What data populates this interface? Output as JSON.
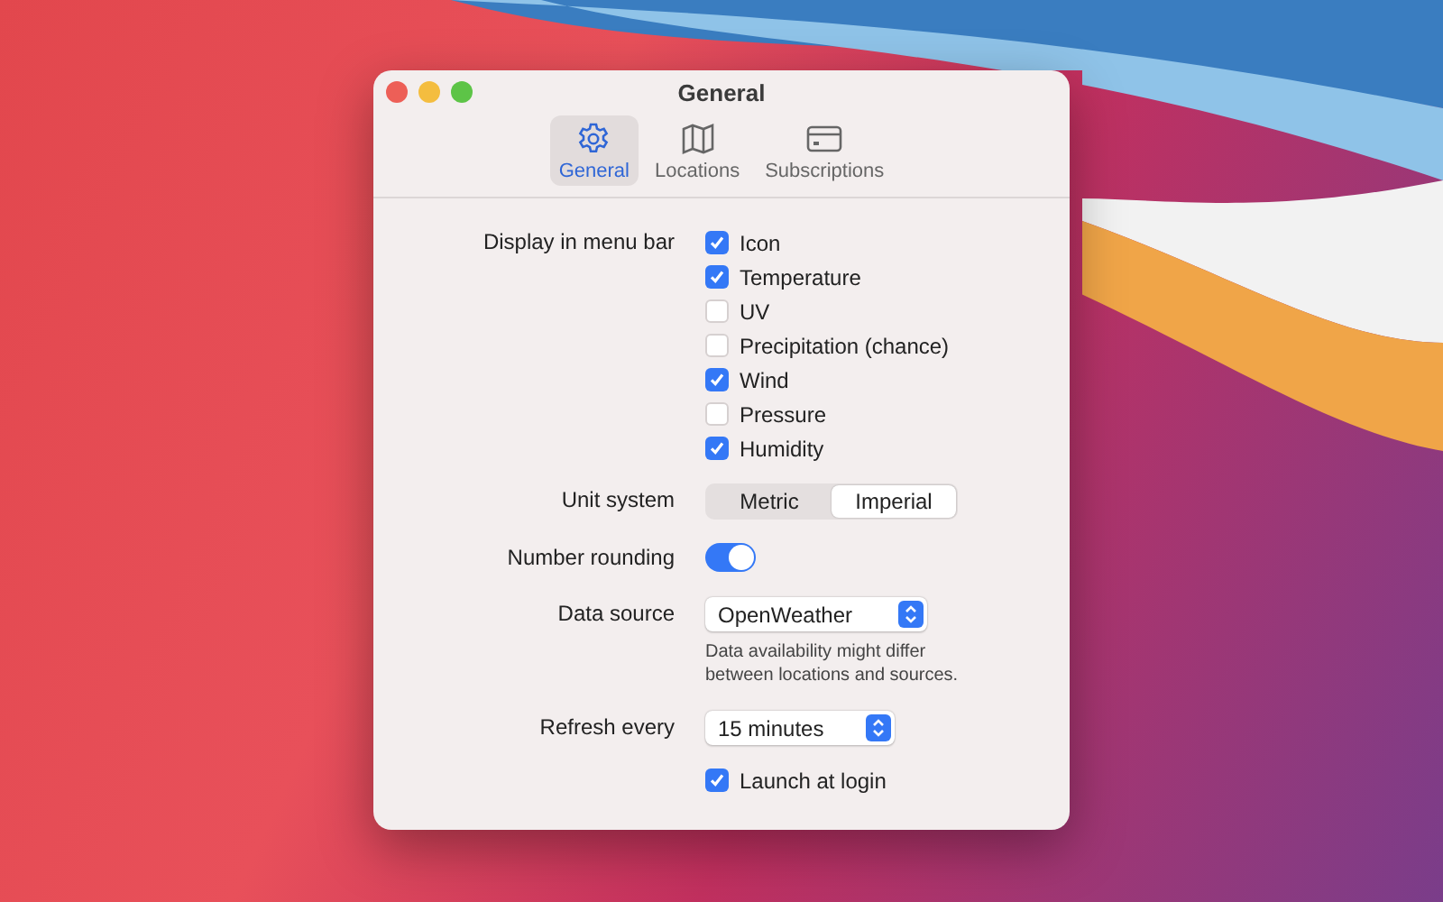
{
  "window": {
    "title": "General"
  },
  "tabs": [
    {
      "label": "General",
      "kind": "gear",
      "selected": true
    },
    {
      "label": "Locations",
      "kind": "map",
      "selected": false
    },
    {
      "label": "Subscriptions",
      "kind": "card",
      "selected": false
    }
  ],
  "menu_bar": {
    "label": "Display in menu bar",
    "items": [
      {
        "label": "Icon",
        "checked": true
      },
      {
        "label": "Temperature",
        "checked": true
      },
      {
        "label": "UV",
        "checked": false
      },
      {
        "label": "Precipitation (chance)",
        "checked": false
      },
      {
        "label": "Wind",
        "checked": true
      },
      {
        "label": "Pressure",
        "checked": false
      },
      {
        "label": "Humidity",
        "checked": true
      }
    ]
  },
  "unit_system": {
    "label": "Unit system",
    "options": [
      {
        "label": "Metric",
        "selected": false
      },
      {
        "label": "Imperial",
        "selected": true
      }
    ]
  },
  "number_rounding": {
    "label": "Number rounding",
    "on": true
  },
  "data_source": {
    "label": "Data source",
    "value": "OpenWeather",
    "note": "Data availability might differ between locations and sources."
  },
  "refresh": {
    "label": "Refresh every",
    "value": "15 minutes"
  },
  "launch_at_login": {
    "label": "Launch at login",
    "checked": true
  }
}
